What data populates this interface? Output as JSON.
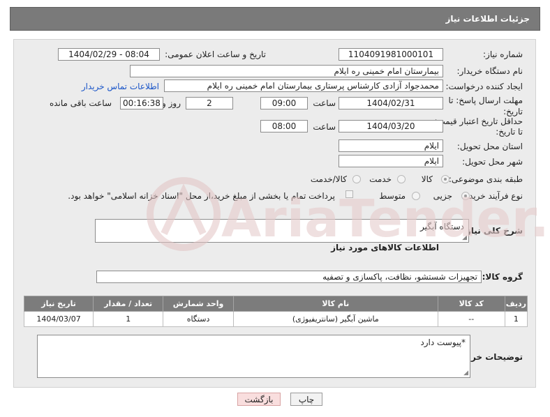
{
  "header": {
    "title": "جزئیات اطلاعات نیاز"
  },
  "form": {
    "need_number_label": "شماره نیاز:",
    "need_number": "1104091981000101",
    "announce_label": "تاریخ و ساعت اعلان عمومی:",
    "announce_value": "1404/02/29 - 08:04",
    "buyer_org_label": "نام دستگاه خریدار:",
    "buyer_org": "بیمارستان امام خمینی  ره  ایلام",
    "requester_label": "ایجاد کننده درخواست:",
    "requester": "محمدجواد آزادی کارشناس پرستاری بیمارستان امام خمینی  ره  ایلام",
    "contact_link": "اطلاعات تماس خریدار",
    "deadline_label_1": "مهلت ارسال پاسخ: تا",
    "deadline_label_2": "تاریخ:",
    "deadline_date": "1404/02/31",
    "time_label": "ساعت",
    "deadline_time": "09:00",
    "days_value": "2",
    "days_label": "روز و",
    "remaining_time": "00:16:38",
    "remaining_label": "ساعت باقی مانده",
    "validity_label_1": "حداقل تاریخ اعتبار قیمت:",
    "validity_label_2": "تا تاریخ:",
    "validity_date": "1404/03/20",
    "validity_time_label": "ساعت",
    "validity_time": "08:00",
    "province_label": "استان محل تحویل:",
    "province": "ایلام",
    "city_label": "شهر محل تحویل:",
    "city": "ایلام",
    "category_label": "طبقه بندی موضوعی:",
    "category_options": [
      "کالا",
      "خدمت",
      "کالا/خدمت"
    ],
    "category_selected": "کالا",
    "process_label": "نوع فرآیند خرید :",
    "process_options": [
      "جزیی",
      "متوسط"
    ],
    "process_selected": "جزیی",
    "payment_note": "پرداخت تمام یا بخشی از مبلغ خرید،از محل \"اسناد خزانه اسلامی\" خواهد بود."
  },
  "summary": {
    "label": "شرح کلی نیاز:",
    "value": "دستگاه آبگیر"
  },
  "goods_section": {
    "title": "اطلاعات کالاهای مورد نیاز",
    "group_label": "گروه کالا:",
    "group_value": "تجهیزات شستشو، نظافت، پاکسازی و تصفیه"
  },
  "table": {
    "headers": [
      "ردیف",
      "کد کالا",
      "نام کالا",
      "واحد شمارش",
      "تعداد / مقدار",
      "تاریخ نیاز"
    ],
    "rows": [
      {
        "row": "1",
        "code": "--",
        "name": "ماشین آبگیر (سانتریفیوژی)",
        "unit": "دستگاه",
        "qty": "1",
        "date": "1404/03/07"
      }
    ]
  },
  "buyer_notes": {
    "label": "توضیحات خریدار:",
    "value": "*پیوست دارد"
  },
  "buttons": {
    "print": "چاپ",
    "back": "بازگشت"
  },
  "watermark": {
    "text": "AriaTender.neT"
  },
  "colors": {
    "header_bg": "#7a7a7a",
    "panel_bg": "#ececec",
    "link": "#1a55c8",
    "back_button": "#f9dede"
  }
}
